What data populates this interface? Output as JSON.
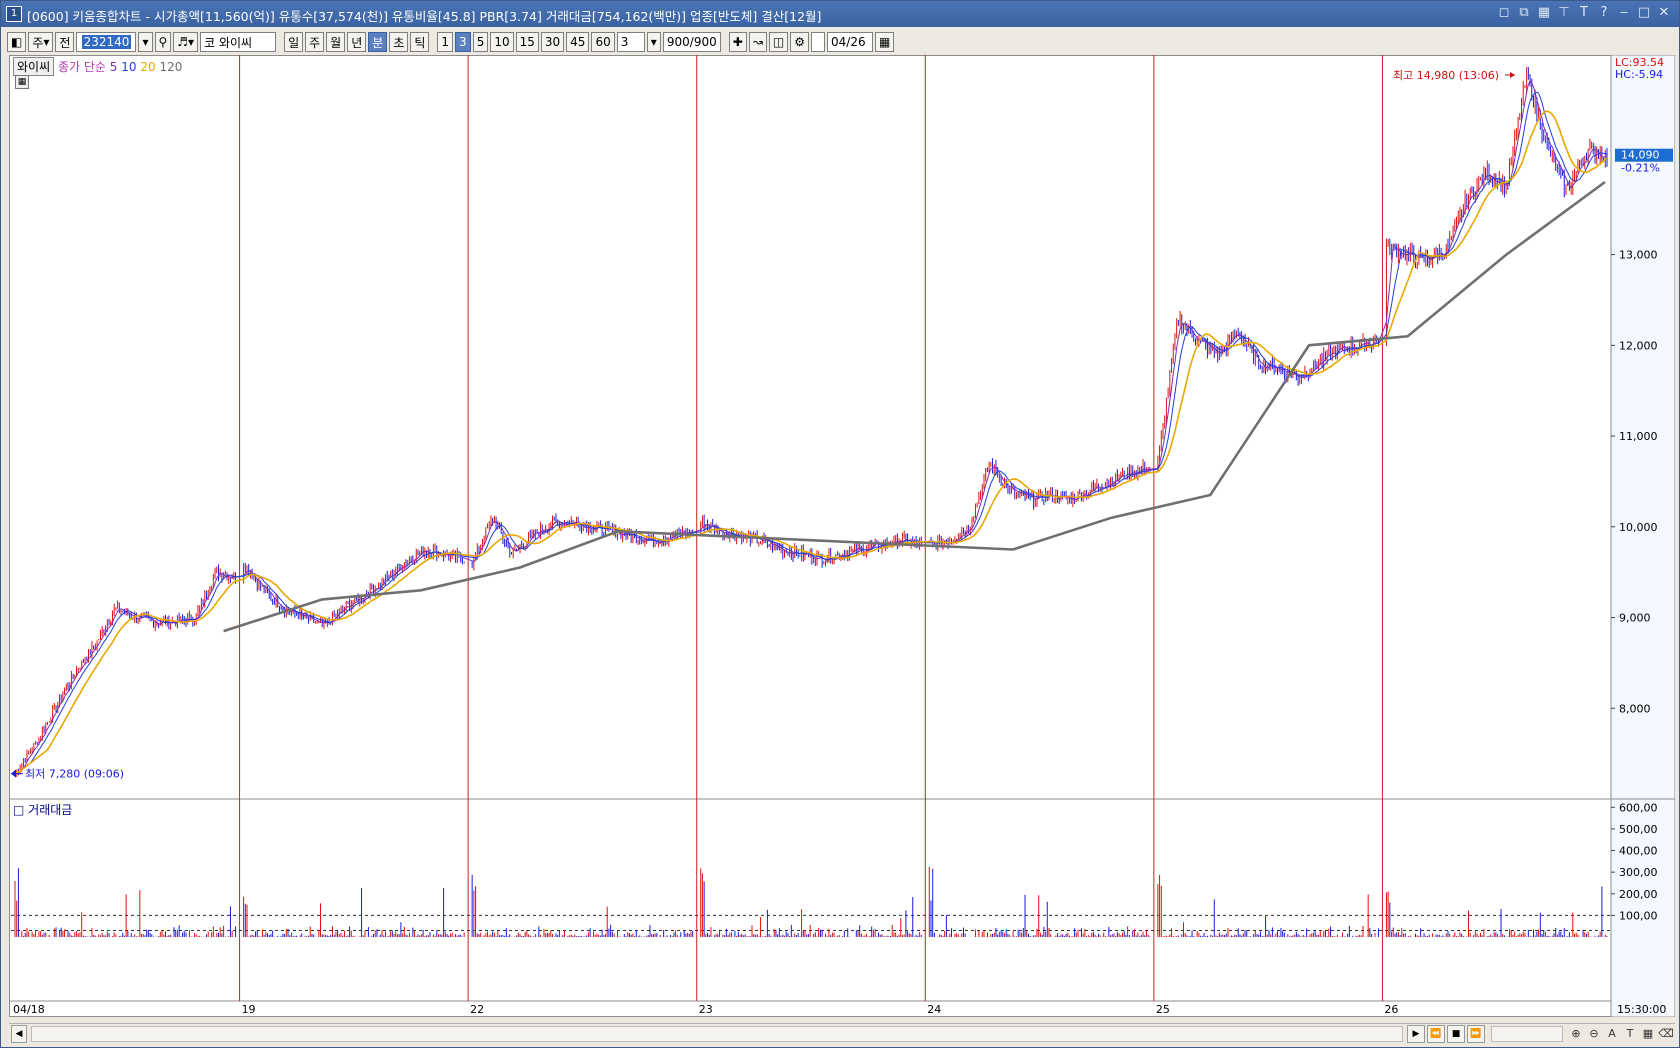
{
  "window": {
    "title": "[0600] 키움종합차트 - 시가총액[11,560(억)] 유통수[37,574(천)] 유통비율[45.8] PBR[3.74] 거래대금[754,162(백만)] 업종[반도체] 결산[12월]",
    "icon_label": "1"
  },
  "toolbar": {
    "market_label": "주",
    "all_label": "전",
    "code_value": "232140",
    "search_icon": "search-icon",
    "stock_prefix": "코",
    "stock_name": "와이씨",
    "period_tabs": [
      "일",
      "주",
      "월",
      "년",
      "분",
      "초",
      "틱"
    ],
    "active_period": "분",
    "minute_options": [
      "1",
      "3",
      "5",
      "10",
      "15",
      "30",
      "45",
      "60"
    ],
    "active_minute": "3",
    "custom_value": "3",
    "count_value": "900/900",
    "date_value": "04/26"
  },
  "chart": {
    "stock_pill": "와이씨",
    "ma_legend": {
      "title": "종가 단순",
      "periods": [
        "5",
        "10",
        "20",
        "120"
      ],
      "colors": [
        "#7b2fb4",
        "#1f3fd8",
        "#e8a800",
        "#707070"
      ]
    },
    "volume_title": "거래대금",
    "lc_label": "LC:93.54",
    "hc_label": "HC:-5.94",
    "current_price": "14,090",
    "current_change": "-0.21%",
    "high_label": "최고 14,980 (13:06)",
    "low_label": "최저 7,280 (09:06)",
    "date_labels": [
      "04/18",
      "19",
      "22",
      "23",
      "24",
      "25",
      "26"
    ],
    "time_label": "15:30:00",
    "colors": {
      "up": "#e01010",
      "down": "#1a1ae0",
      "separator": "#cc2020",
      "price_tag_bg": "#1c6cd2"
    }
  },
  "chart_data": {
    "type": "candlestick",
    "price_axis": {
      "ticks": [
        8000,
        9000,
        10000,
        11000,
        12000,
        13000,
        14000
      ],
      "labels": [
        "8,000",
        "9,000",
        "10,000",
        "11,000",
        "12,000",
        "13,000"
      ]
    },
    "volume_axis": {
      "ticks": [
        100,
        200,
        300,
        400,
        500,
        600
      ],
      "labels": [
        "100,00",
        "200,00",
        "300,00",
        "400,00",
        "500,00",
        "600,00"
      ]
    },
    "days": [
      "04/18",
      "19",
      "22",
      "23",
      "24",
      "25",
      "26"
    ],
    "price_path_by_day": [
      [
        7280,
        7600,
        8000,
        8400,
        8700,
        9100,
        9000,
        8950,
        8950,
        9000,
        9500,
        9450
      ],
      [
        9600,
        9300,
        9100,
        9000,
        8900,
        9100,
        9250,
        9400,
        9600,
        9750,
        9700,
        9650
      ],
      [
        9600,
        10100,
        9700,
        9900,
        10050,
        10050,
        10000,
        9950,
        9900,
        9850,
        9900,
        9950
      ],
      [
        10050,
        9950,
        9900,
        9850,
        9750,
        9700,
        9650,
        9700,
        9750,
        9800,
        9850,
        9800
      ],
      [
        9800,
        9850,
        10000,
        10700,
        10400,
        10300,
        10350,
        10300,
        10400,
        10500,
        10600,
        10650
      ],
      [
        10700,
        12300,
        12050,
        11900,
        12150,
        11800,
        11750,
        11650,
        11800,
        11950,
        12000,
        12050
      ],
      [
        13100,
        13000,
        12950,
        13050,
        13600,
        13900,
        13750,
        14980,
        14200,
        13700,
        14150,
        14090
      ]
    ],
    "ma120_path": [
      8850,
      9200,
      9300,
      9550,
      9950,
      9900,
      9850,
      9800,
      9750,
      10100,
      10350,
      12000,
      12100,
      13000,
      13800
    ],
    "high": {
      "value": 14980,
      "time": "13:06"
    },
    "low": {
      "value": 7280,
      "time": "09:06"
    },
    "last": 14090,
    "change_pct": -0.21
  }
}
